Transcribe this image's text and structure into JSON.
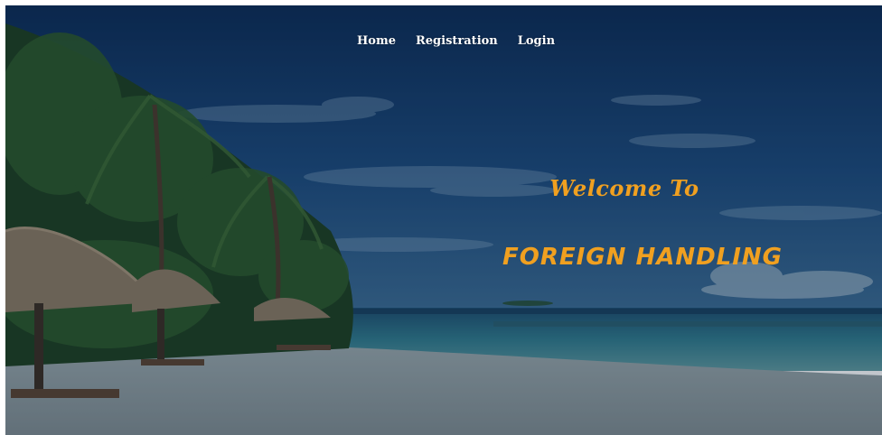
{
  "nav": {
    "items": [
      {
        "label": "Home"
      },
      {
        "label": "Registration"
      },
      {
        "label": "Login"
      }
    ]
  },
  "hero": {
    "welcome": "Welcome To",
    "title": "FOREIGN HANDLING",
    "title_color": "#f0a020"
  },
  "background": {
    "sky_color": "#0f3566",
    "sea_color": "#2d6d85",
    "sand_color": "#8c9ca2"
  }
}
